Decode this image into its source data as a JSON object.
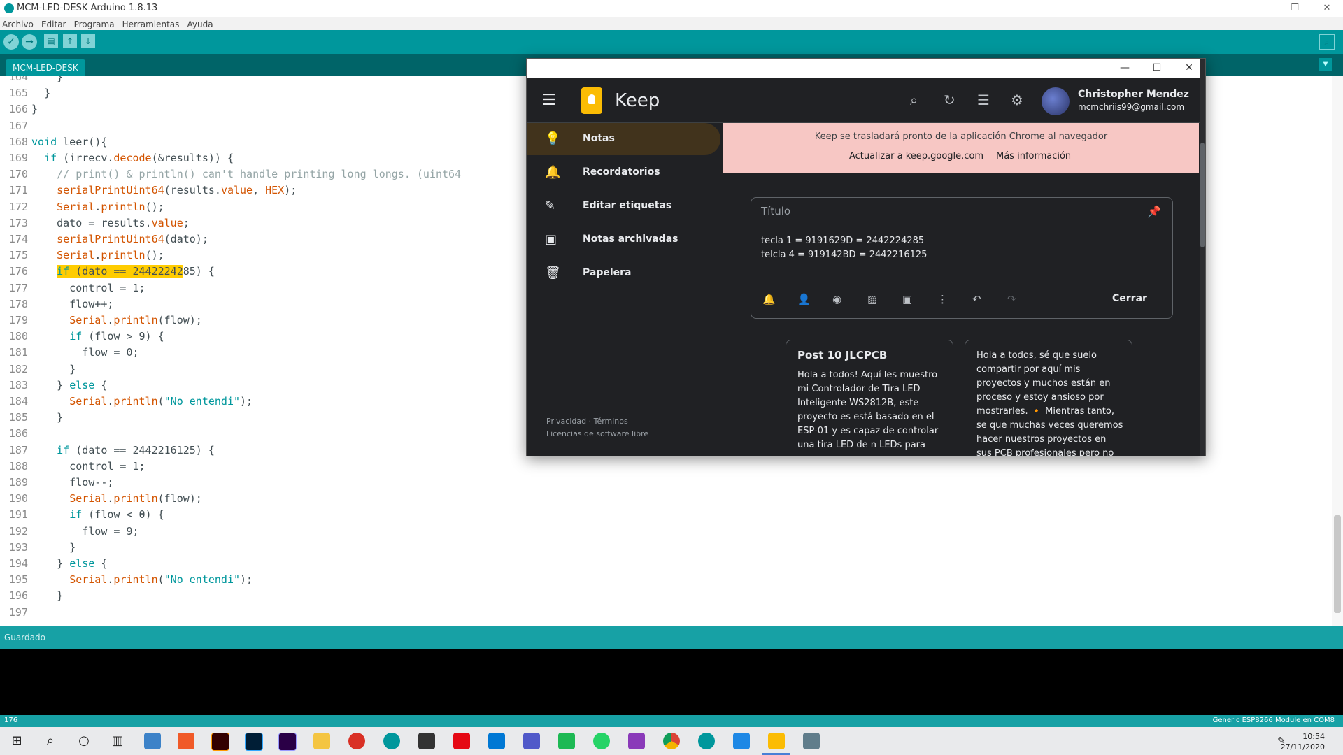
{
  "arduino": {
    "window_title": "MCM-LED-DESK Arduino 1.8.13",
    "menu": [
      "Archivo",
      "Editar",
      "Programa",
      "Herramientas",
      "Ayuda"
    ],
    "tab": "MCM-LED-DESK",
    "status": "Guardado",
    "line_indicator": "176",
    "board": "Generic ESP8266 Module en COM8"
  },
  "code_lines": [
    {
      "n": "164",
      "t": "    }"
    },
    {
      "n": "165",
      "t": "  }"
    },
    {
      "n": "166",
      "t": "}"
    },
    {
      "n": "167",
      "t": ""
    },
    {
      "n": "168",
      "t": "void leer(){"
    },
    {
      "n": "169",
      "t": "  if (irrecv.decode(&results)) {"
    },
    {
      "n": "170",
      "t": "    // print() & println() can't handle printing long longs. (uint64"
    },
    {
      "n": "171",
      "t": "    serialPrintUint64(results.value, HEX);"
    },
    {
      "n": "172",
      "t": "    Serial.println();"
    },
    {
      "n": "173",
      "t": "    dato = results.value;"
    },
    {
      "n": "174",
      "t": "    serialPrintUint64(dato);"
    },
    {
      "n": "175",
      "t": "    Serial.println();"
    },
    {
      "n": "176",
      "t": "    if (dato == 2442224285) {"
    },
    {
      "n": "177",
      "t": "      control = 1;"
    },
    {
      "n": "178",
      "t": "      flow++;"
    },
    {
      "n": "179",
      "t": "      Serial.println(flow);"
    },
    {
      "n": "180",
      "t": "      if (flow > 9) {"
    },
    {
      "n": "181",
      "t": "        flow = 0;"
    },
    {
      "n": "182",
      "t": "      }"
    },
    {
      "n": "183",
      "t": "    } else {"
    },
    {
      "n": "184",
      "t": "      Serial.println(\"No entendi\");"
    },
    {
      "n": "185",
      "t": "    }"
    },
    {
      "n": "186",
      "t": ""
    },
    {
      "n": "187",
      "t": "    if (dato == 2442216125) {"
    },
    {
      "n": "188",
      "t": "      control = 1;"
    },
    {
      "n": "189",
      "t": "      flow--;"
    },
    {
      "n": "190",
      "t": "      Serial.println(flow);"
    },
    {
      "n": "191",
      "t": "      if (flow < 0) {"
    },
    {
      "n": "192",
      "t": "        flow = 9;"
    },
    {
      "n": "193",
      "t": "      }"
    },
    {
      "n": "194",
      "t": "    } else {"
    },
    {
      "n": "195",
      "t": "      Serial.println(\"No entendi\");"
    },
    {
      "n": "196",
      "t": "    }"
    },
    {
      "n": "197",
      "t": ""
    }
  ],
  "keep": {
    "app_name": "Keep",
    "user_name": "Christopher Mendez",
    "user_email": "mcmchriis99@gmail.com",
    "nav": [
      "Notas",
      "Recordatorios",
      "Editar etiquetas",
      "Notas archivadas",
      "Papelera"
    ],
    "banner_text": "Keep se trasladará pronto de la aplicación Chrome al navegador",
    "banner_update": "Actualizar a keep.google.com",
    "banner_more": "Más información",
    "note_title_placeholder": "Título",
    "note_line1": "tecla 1 = 9191629D = 2442224285",
    "note_line2": "telcla 4 = 919142BD = 2442216125",
    "close_label": "Cerrar",
    "footer_privacy": "Privacidad",
    "footer_sep": "·",
    "footer_terms": "Términos",
    "footer_licenses": "Licencias de software libre",
    "card1_title": "Post 10 JLCPCB",
    "card1_body": "Hola a todos! Aquí les muestro mi Controlador de Tira LED Inteligente WS2812B, este proyecto es está basado en el ESP-01 y es capaz de controlar una tira LED de n LEDs para",
    "card2_body": "Hola a todos, sé que suelo compartir por aquí mis proyectos y muchos están en proceso y estoy ansioso por mostrarles. 🔸 Mientras tanto, se que muchas veces queremos hacer nuestros proyectos en sus PCB profesionales pero no"
  },
  "taskbar": {
    "time": "10:54",
    "date": "27/11/2020"
  }
}
